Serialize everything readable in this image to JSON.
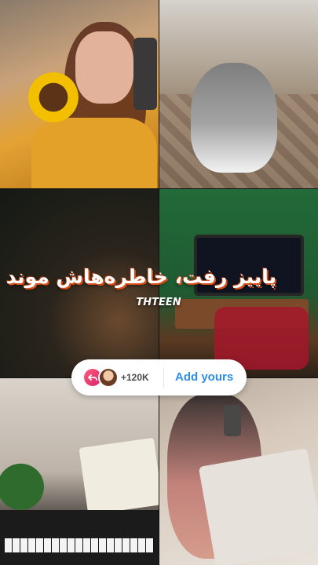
{
  "story": {
    "caption": "پاییز رفت، خاطره‌هاش موند",
    "tag": "THTEEN"
  },
  "add_yours": {
    "count": "+120K",
    "label": "Add yours",
    "accent": "#2f8de2",
    "reply_icon_color": "#e6376f"
  }
}
